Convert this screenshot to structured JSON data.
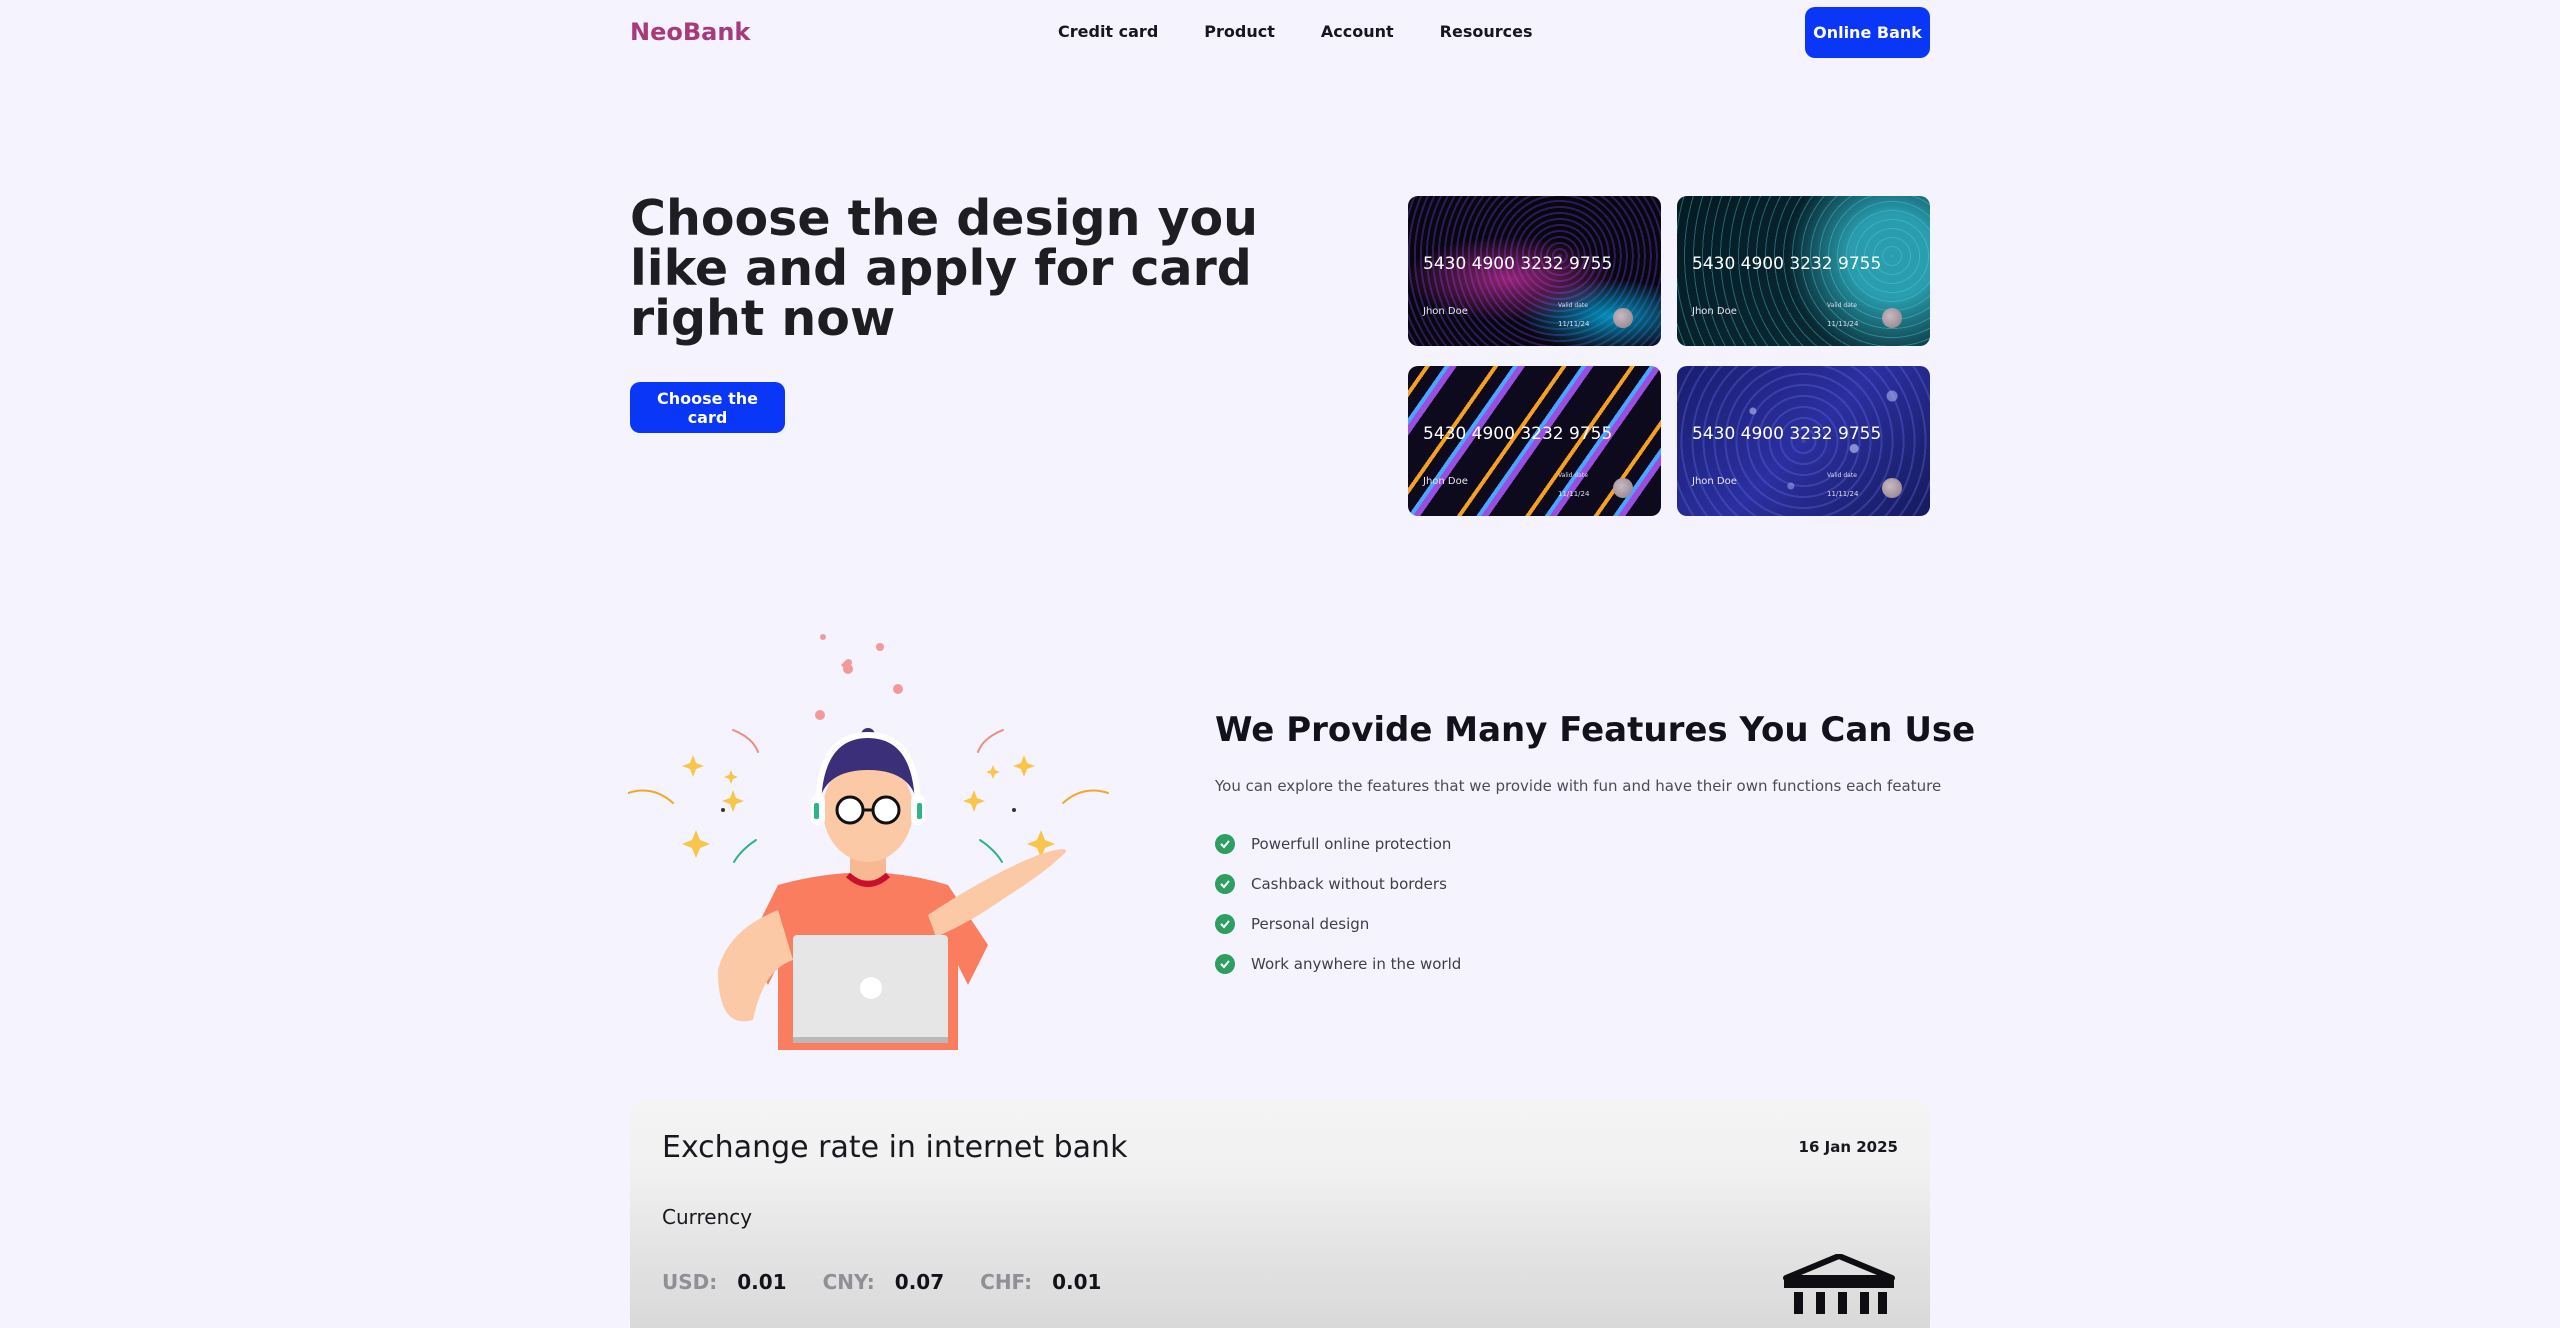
{
  "header": {
    "logo": "NeoBank",
    "nav": [
      "Credit card",
      "Product",
      "Account",
      "Resources"
    ],
    "cta": "Online Bank"
  },
  "hero": {
    "title": "Choose the design you like and apply for card right now",
    "button": "Choose the card",
    "cards": [
      {
        "number": "5430 4900 3232 9755",
        "holder": "Jhon Doe",
        "valid_label": "Valid date",
        "date": "11/11/24"
      },
      {
        "number": "5430 4900 3232 9755",
        "holder": "Jhon Doe",
        "valid_label": "Valid date",
        "date": "11/11/24"
      },
      {
        "number": "5430 4900 3232 9755",
        "holder": "Jhon Doe",
        "valid_label": "Valid date",
        "date": "11/11/24"
      },
      {
        "number": "5430 4900 3232 9755",
        "holder": "Jhon Doe",
        "valid_label": "Valid date",
        "date": "11/11/24"
      }
    ]
  },
  "features": {
    "title": "We Provide Many Features You Can Use",
    "description": "You can explore the features that we provide with fun and have their own functions each feature",
    "items": [
      "Powerfull online protection",
      "Cashback without borders",
      "Personal design",
      "Work anywhere in the world"
    ]
  },
  "exchange": {
    "title": "Exchange rate in internet bank",
    "date": "16 Jan 2025",
    "currency_label": "Currency",
    "rates": [
      {
        "code": "USD:",
        "value": "0.01"
      },
      {
        "code": "CNY:",
        "value": "0.07"
      },
      {
        "code": "CHF:",
        "value": "0.01"
      }
    ]
  },
  "colors": {
    "brand": "#a63a7a",
    "primary_button": "#0a36f7",
    "check": "#2e9e62",
    "background": "#f5f3fe"
  },
  "icons": {
    "feature_item": "check-circle-icon",
    "exchange": "bank-building-icon"
  }
}
